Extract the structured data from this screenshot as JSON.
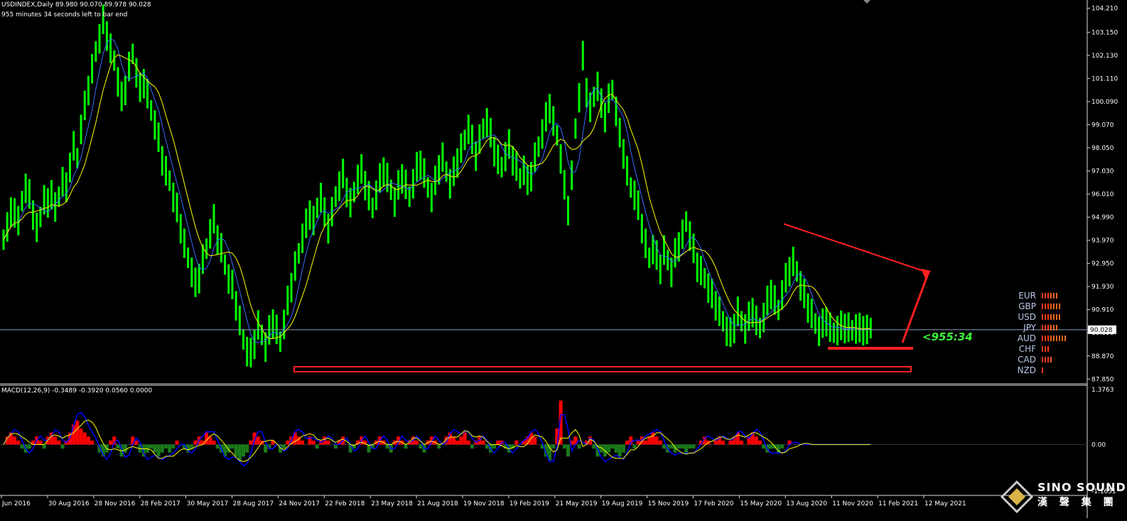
{
  "header": {
    "line1": "USDINDEX,Daily  89.980 90.070 89.978 90.028",
    "line2": "955 minutes 34 seconds left to bar end"
  },
  "countdown": "<955:34",
  "price_badge": "90.028",
  "macd_header": "MACD(12,26,9) -0.3489 -0.3920 0.0560 0.0000",
  "macd_axis": {
    "top": "1.3763",
    "zero": "0.00",
    "bottom": "-1.1651"
  },
  "strength_panel": [
    {
      "label": "EUR",
      "bars": 6,
      "color": "#e8671a"
    },
    {
      "label": "GBP",
      "bars": 7,
      "color": "#e8671a"
    },
    {
      "label": "USD",
      "bars": 7,
      "color": "#e8671a"
    },
    {
      "label": "JPY",
      "bars": 6,
      "color": "#e8671a"
    },
    {
      "label": "AUD",
      "bars": 9,
      "color": "#e8671a"
    },
    {
      "label": "CHF",
      "bars": 3,
      "color": "#e8671a"
    },
    {
      "label": "CAD",
      "bars": 4,
      "color": "#e8671a"
    },
    {
      "label": "NZD",
      "bars": 1,
      "color": "#e8671a"
    }
  ],
  "logo": {
    "title": "SINO SOUND",
    "subtitle": "漢 聲 集 團"
  },
  "colors": {
    "price": "#00ff00",
    "ma_fast": "#3a6bff",
    "ma_slow": "#ffff00",
    "annotation": "#ff2020",
    "macd_pos": "#ff0000",
    "macd_neg": "#1a7a1a",
    "macd_line": "#0000ff",
    "signal_line": "#ffff00",
    "bid_line": "#8a9fc0"
  },
  "chart_data": {
    "type": "line",
    "title": "USDINDEX,Daily",
    "price_axis_labels": [
      "104.210",
      "103.150",
      "102.130",
      "101.110",
      "100.090",
      "99.070",
      "98.050",
      "97.030",
      "96.010",
      "94.990",
      "93.970",
      "92.950",
      "91.930",
      "90.910",
      "89.890",
      "88.870",
      "87.850"
    ],
    "ylim": [
      87.64,
      104.51
    ],
    "date_labels": [
      "Jun 2016",
      "30 Aug 2016",
      "28 Nov 2016",
      "28 Feb 2017",
      "30 May 2017",
      "28 Aug 2017",
      "24 Nov 2017",
      "22 Feb 2018",
      "23 May 2018",
      "21 Aug 2018",
      "19 Nov 2018",
      "19 Feb 2019",
      "21 May 2019",
      "19 Aug 2019",
      "15 Nov 2019",
      "17 Feb 2020",
      "15 May 2020",
      "13 Aug 2020",
      "11 Nov 2020",
      "11 Feb 2021",
      "12 May 2021"
    ],
    "x": [
      0,
      1,
      2,
      3,
      4,
      5,
      6,
      7,
      8,
      9,
      10,
      11,
      12,
      13,
      14,
      15,
      16,
      17,
      18,
      19,
      20,
      21,
      22,
      23,
      24,
      25,
      26,
      27,
      28,
      29,
      30,
      31,
      32,
      33,
      34,
      35,
      36,
      37,
      38,
      39,
      40,
      41,
      42,
      43,
      44,
      45,
      46,
      47,
      48,
      49,
      50,
      51,
      52,
      53,
      54,
      55,
      56,
      57,
      58,
      59,
      60,
      61,
      62,
      63,
      64,
      65,
      66,
      67,
      68,
      69,
      70,
      71,
      72,
      73,
      74,
      75,
      76,
      77,
      78,
      79,
      80,
      81,
      82,
      83,
      84,
      85,
      86,
      87,
      88,
      89,
      90,
      91,
      92,
      93,
      94,
      95,
      96,
      97,
      98,
      99,
      100,
      101,
      102,
      103,
      104,
      105,
      106,
      107,
      108,
      109,
      110,
      111,
      112,
      113,
      114,
      115,
      116,
      117,
      118,
      119,
      120,
      121,
      122,
      123,
      124,
      125,
      126,
      127,
      128,
      129,
      130,
      131,
      132,
      133,
      134,
      135,
      136,
      137,
      138,
      139,
      140,
      141,
      142,
      143,
      144,
      145,
      146,
      147,
      148,
      149,
      150,
      151,
      152,
      153,
      154,
      155,
      156,
      157,
      158,
      159,
      160,
      161,
      162,
      163,
      164,
      165,
      166,
      167,
      168,
      169,
      170,
      171,
      172,
      173,
      174,
      175,
      176,
      177,
      178,
      179,
      180,
      181,
      182,
      183,
      184,
      185,
      186,
      187,
      188,
      189,
      190,
      191,
      192,
      193,
      194,
      195,
      196,
      197,
      198,
      199,
      200,
      201,
      202,
      203,
      204,
      205,
      206,
      207,
      208,
      209,
      210,
      211,
      212,
      213,
      214,
      215,
      216,
      217,
      218,
      219,
      220,
      221,
      222,
      223,
      224,
      225,
      226,
      227,
      228,
      229,
      230,
      231,
      232,
      233,
      234,
      235,
      236,
      237,
      238,
      239,
      240,
      241,
      242,
      243,
      244,
      245,
      246,
      247,
      248,
      249,
      250,
      251,
      252,
      253,
      254
    ],
    "series": [
      {
        "name": "Close",
        "values": [
          94.0,
          94.6,
          95.1,
          95.3,
          94.8,
          95.7,
          96.3,
          95.9,
          95.2,
          94.5,
          95.0,
          95.8,
          95.5,
          96.1,
          95.4,
          95.9,
          96.6,
          96.2,
          97.3,
          98.1,
          97.6,
          98.9,
          99.8,
          100.7,
          101.5,
          102.3,
          102.9,
          103.6,
          103.1,
          102.4,
          101.9,
          101.0,
          100.2,
          100.7,
          101.6,
          102.2,
          101.4,
          100.6,
          101.0,
          100.4,
          99.7,
          99.1,
          98.4,
          97.6,
          97.0,
          96.6,
          95.9,
          95.3,
          94.6,
          93.8,
          93.2,
          92.6,
          92.0,
          92.4,
          93.1,
          93.6,
          94.3,
          94.8,
          94.1,
          93.6,
          92.9,
          92.3,
          91.9,
          91.2,
          90.4,
          89.6,
          89.1,
          88.9,
          89.5,
          90.2,
          89.8,
          89.3,
          89.9,
          90.4,
          90.0,
          89.5,
          90.3,
          91.2,
          92.0,
          92.8,
          93.4,
          94.1,
          94.6,
          95.2,
          94.8,
          95.4,
          95.9,
          95.1,
          94.6,
          95.2,
          95.9,
          96.4,
          96.8,
          96.2,
          95.6,
          96.1,
          96.7,
          97.0,
          96.5,
          95.9,
          95.4,
          96.0,
          96.6,
          97.1,
          96.7,
          96.2,
          95.7,
          96.3,
          96.8,
          96.4,
          95.9,
          96.5,
          97.1,
          97.4,
          96.9,
          96.3,
          95.9,
          96.5,
          97.2,
          97.6,
          97.0,
          96.5,
          96.9,
          97.5,
          98.0,
          98.4,
          98.9,
          98.3,
          97.8,
          98.4,
          98.9,
          99.2,
          98.6,
          98.0,
          97.5,
          97.2,
          97.7,
          98.1,
          97.6,
          97.2,
          96.7,
          97.1,
          96.5,
          96.9,
          97.6,
          98.1,
          98.7,
          99.3,
          99.9,
          99.2,
          98.6,
          97.6,
          96.3,
          95.4,
          96.8,
          98.9,
          100.3,
          102.0,
          100.6,
          99.8,
          100.3,
          100.8,
          99.9,
          99.5,
          100.2,
          100.6,
          99.7,
          98.6,
          97.9,
          97.0,
          96.3,
          96.0,
          95.4,
          94.6,
          93.8,
          93.2,
          93.6,
          93.2,
          92.8,
          93.5,
          93.1,
          92.6,
          93.3,
          93.8,
          94.2,
          94.8,
          94.2,
          93.5,
          92.9,
          92.6,
          92.3,
          91.9,
          91.5,
          91.2,
          90.8,
          90.4,
          90.0,
          89.8,
          90.2,
          90.8,
          90.4,
          90.1,
          90.5,
          90.9,
          90.4,
          90.1,
          90.6,
          91.2,
          91.7,
          91.3,
          90.9,
          91.6,
          92.2,
          92.7,
          93.0,
          92.6,
          92.0,
          91.5,
          91.1,
          90.7,
          90.3,
          90.0,
          90.2,
          90.5,
          90.1,
          89.9,
          90.028,
          90.1,
          90.2,
          90.1,
          90.0,
          90.1,
          90.0,
          90.1,
          90.0,
          90.1,
          90.0,
          90.1,
          90.0,
          90.1,
          90.0,
          90.1,
          90.0,
          90.1,
          90.0
        ]
      }
    ],
    "macd_ylim": [
      -1.1651,
      1.3763
    ],
    "macd_hist": [
      0.0,
      0.2,
      0.3,
      0.2,
      0.1,
      -0.1,
      -0.2,
      -0.1,
      0.1,
      0.2,
      0.1,
      -0.1,
      0.2,
      0.3,
      0.2,
      0.1,
      -0.1,
      0.1,
      0.3,
      0.5,
      0.6,
      0.4,
      0.3,
      0.2,
      0.1,
      0.0,
      -0.2,
      -0.3,
      -0.2,
      0.1,
      0.2,
      -0.1,
      -0.3,
      -0.2,
      0.0,
      0.2,
      0.1,
      -0.2,
      -0.3,
      -0.2,
      -0.1,
      -0.2,
      -0.3,
      -0.2,
      -0.1,
      -0.2,
      -0.1,
      0.1,
      0.0,
      -0.1,
      -0.2,
      -0.1,
      0.1,
      0.2,
      0.1,
      0.3,
      0.2,
      0.1,
      -0.1,
      -0.2,
      -0.3,
      -0.2,
      -0.1,
      -0.3,
      -0.4,
      -0.3,
      -0.2,
      0.1,
      0.3,
      0.2,
      0.1,
      -0.2,
      -0.1,
      0.1,
      0.0,
      -0.2,
      -0.1,
      0.1,
      0.2,
      0.3,
      0.2,
      0.1,
      0.0,
      0.2,
      0.1,
      -0.1,
      0.1,
      0.2,
      0.1,
      0.0,
      -0.1,
      0.1,
      0.2,
      0.0,
      -0.2,
      -0.1,
      0.1,
      0.2,
      0.1,
      -0.2,
      -0.1,
      0.1,
      0.2,
      0.1,
      -0.1,
      -0.2,
      0.1,
      0.2,
      0.1,
      -0.1,
      0.1,
      0.2,
      0.1,
      -0.1,
      -0.2,
      0.1,
      0.2,
      0.1,
      -0.1,
      0.0,
      0.2,
      0.3,
      0.2,
      0.1,
      0.2,
      0.3,
      0.1,
      -0.1,
      0.1,
      0.2,
      0.1,
      -0.1,
      -0.2,
      -0.1,
      0.1,
      0.1,
      -0.1,
      -0.2,
      -0.1,
      0.1,
      0.0,
      0.1,
      0.2,
      0.3,
      0.2,
      0.0,
      -0.1,
      -0.3,
      -0.4,
      -0.1,
      0.4,
      1.1,
      -0.1,
      -0.3,
      0.1,
      0.2,
      -0.1,
      0.0,
      0.1,
      0.2,
      -0.1,
      -0.3,
      -0.2,
      -0.3,
      -0.2,
      -0.1,
      -0.2,
      -0.3,
      -0.2,
      0.1,
      0.2,
      -0.1,
      0.1,
      0.2,
      0.1,
      0.2,
      0.3,
      0.2,
      0.1,
      -0.1,
      -0.2,
      -0.1,
      -0.2,
      -0.1,
      -0.1,
      -0.2,
      -0.1,
      -0.1,
      0.0,
      0.1,
      0.2,
      0.1,
      0.0,
      0.1,
      0.2,
      0.1,
      0.0,
      0.1,
      0.2,
      0.3,
      0.1,
      0.0,
      0.2,
      0.3,
      0.2,
      0.1,
      -0.1,
      -0.2,
      -0.1,
      -0.1,
      -0.2,
      -0.1,
      0.0,
      0.1,
      0.0,
      0.0,
      0.0,
      0.0,
      0.0,
      0.0,
      0.0,
      0.0,
      0.0,
      0.0,
      0.0,
      0.0,
      0.0,
      0.0,
      0.0,
      0.0,
      0.0,
      0.0,
      0.0,
      0.0,
      0.0,
      0.0,
      0.0,
      0.0
    ]
  }
}
